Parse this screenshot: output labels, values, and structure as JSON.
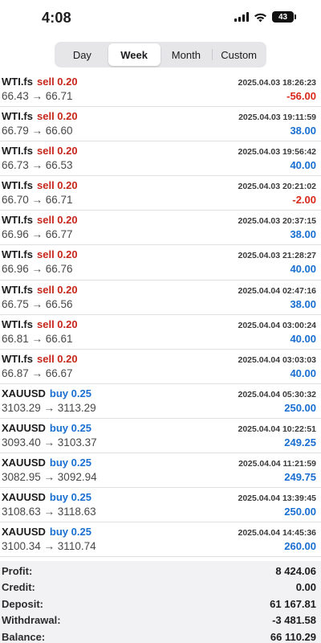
{
  "status_bar": {
    "time": "4:08",
    "battery": "43"
  },
  "period_tabs": [
    {
      "label": "Day",
      "active": false
    },
    {
      "label": "Week",
      "active": true
    },
    {
      "label": "Month",
      "active": false
    },
    {
      "label": "Custom",
      "active": false
    }
  ],
  "trades": [
    {
      "symbol": "WTI.fs",
      "side": "sell",
      "volume": "sell 0.20",
      "datetime": "2025.04.03 18:26:23",
      "prices": "66.43 → 66.71",
      "profit": "-56.00"
    },
    {
      "symbol": "WTI.fs",
      "side": "sell",
      "volume": "sell 0.20",
      "datetime": "2025.04.03 19:11:59",
      "prices": "66.79 → 66.60",
      "profit": "38.00"
    },
    {
      "symbol": "WTI.fs",
      "side": "sell",
      "volume": "sell 0.20",
      "datetime": "2025.04.03 19:56:42",
      "prices": "66.73 → 66.53",
      "profit": "40.00"
    },
    {
      "symbol": "WTI.fs",
      "side": "sell",
      "volume": "sell 0.20",
      "datetime": "2025.04.03 20:21:02",
      "prices": "66.70 → 66.71",
      "profit": "-2.00"
    },
    {
      "symbol": "WTI.fs",
      "side": "sell",
      "volume": "sell 0.20",
      "datetime": "2025.04.03 20:37:15",
      "prices": "66.96 → 66.77",
      "profit": "38.00"
    },
    {
      "symbol": "WTI.fs",
      "side": "sell",
      "volume": "sell 0.20",
      "datetime": "2025.04.03 21:28:27",
      "prices": "66.96 → 66.76",
      "profit": "40.00"
    },
    {
      "symbol": "WTI.fs",
      "side": "sell",
      "volume": "sell 0.20",
      "datetime": "2025.04.04 02:47:16",
      "prices": "66.75 → 66.56",
      "profit": "38.00"
    },
    {
      "symbol": "WTI.fs",
      "side": "sell",
      "volume": "sell 0.20",
      "datetime": "2025.04.04 03:00:24",
      "prices": "66.81 → 66.61",
      "profit": "40.00"
    },
    {
      "symbol": "WTI.fs",
      "side": "sell",
      "volume": "sell 0.20",
      "datetime": "2025.04.04 03:03:03",
      "prices": "66.87 → 66.67",
      "profit": "40.00"
    },
    {
      "symbol": "XAUUSD",
      "side": "buy",
      "volume": "buy 0.25",
      "datetime": "2025.04.04 05:30:32",
      "prices": "3103.29 → 3113.29",
      "profit": "250.00"
    },
    {
      "symbol": "XAUUSD",
      "side": "buy",
      "volume": "buy 0.25",
      "datetime": "2025.04.04 10:22:51",
      "prices": "3093.40 → 3103.37",
      "profit": "249.25"
    },
    {
      "symbol": "XAUUSD",
      "side": "buy",
      "volume": "buy 0.25",
      "datetime": "2025.04.04 11:21:59",
      "prices": "3082.95 → 3092.94",
      "profit": "249.75"
    },
    {
      "symbol": "XAUUSD",
      "side": "buy",
      "volume": "buy 0.25",
      "datetime": "2025.04.04 13:39:45",
      "prices": "3108.63 → 3118.63",
      "profit": "250.00"
    },
    {
      "symbol": "XAUUSD",
      "side": "buy",
      "volume": "buy 0.25",
      "datetime": "2025.04.04 14:45:36",
      "prices": "3100.34 → 3110.74",
      "profit": "260.00"
    }
  ],
  "summary": [
    {
      "label": "Profit:",
      "value": "8 424.06"
    },
    {
      "label": "Credit:",
      "value": "0.00"
    },
    {
      "label": "Deposit:",
      "value": "61 167.81"
    },
    {
      "label": "Withdrawal:",
      "value": "-3 481.58"
    },
    {
      "label": "Balance:",
      "value": "66 110.29"
    }
  ],
  "colors": {
    "sell": "#c7261b",
    "buy": "#1a6fd1",
    "profit_positive": "#1a6fd1",
    "profit_negative": "#d9281c"
  },
  "icons": [
    "signal-icon",
    "wifi-icon",
    "battery-icon"
  ]
}
